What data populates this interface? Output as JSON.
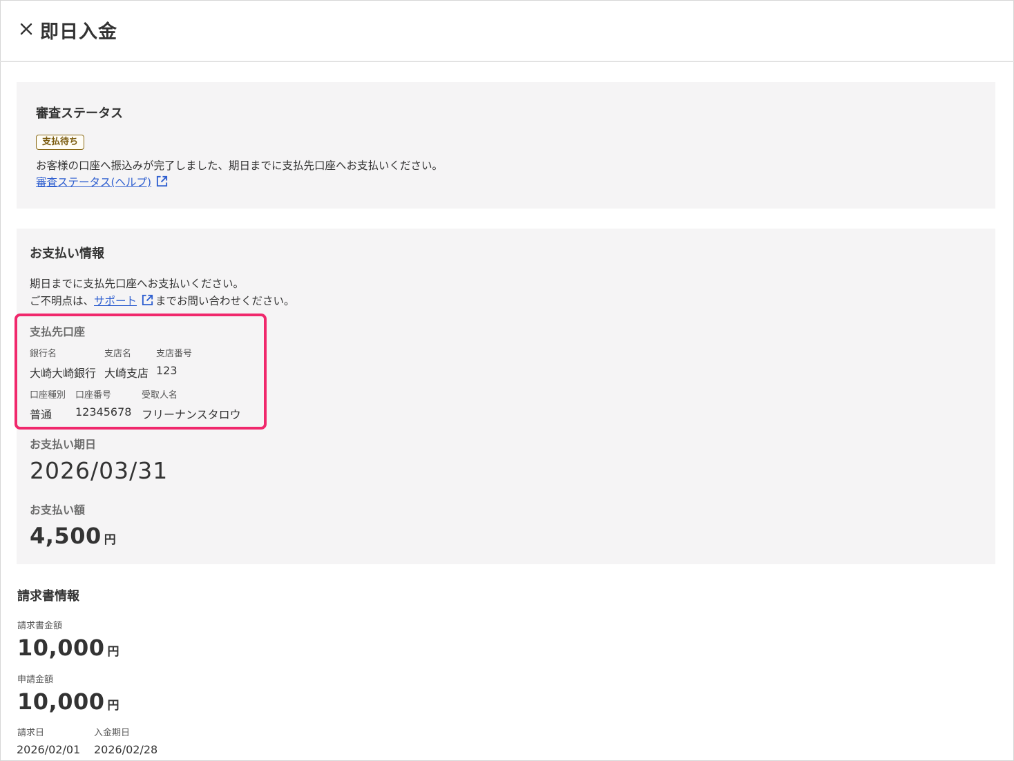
{
  "header": {
    "title": "即日入金"
  },
  "review_status": {
    "heading": "審査ステータス",
    "badge": "支払待ち",
    "message": "お客様の口座へ振込みが完了しました、期日までに支払先口座へお支払いください。",
    "help_link": "審査ステータス(ヘルプ)"
  },
  "payment_info": {
    "heading": "お支払い情報",
    "line1": "期日までに支払先口座へお支払いください。",
    "line2_prefix": "ご不明点は、",
    "support_link": "サポート",
    "line2_suffix": "までお問い合わせください。",
    "account": {
      "heading": "支払先口座",
      "bank_label": "銀行名",
      "bank_value": "大崎大崎銀行",
      "branch_label": "支店名",
      "branch_value": "大崎支店",
      "branch_no_label": "支店番号",
      "branch_no_value": "123",
      "type_label": "口座種別",
      "type_value": "普通",
      "number_label": "口座番号",
      "number_value": "12345678",
      "holder_label": "受取人名",
      "holder_value": "フリーナンスタロウ"
    },
    "due_label": "お支払い期日",
    "due_value": "2026/03/31",
    "amount_label": "お支払い額",
    "amount_value": "4,500",
    "currency": "円"
  },
  "invoice_info": {
    "heading": "請求書情報",
    "invoice_amount_label": "請求書金額",
    "invoice_amount_value": "10,000",
    "applied_amount_label": "申請金額",
    "applied_amount_value": "10,000",
    "currency": "円",
    "invoice_date_label": "請求日",
    "invoice_date_value": "2026/02/01",
    "deposit_due_label": "入金期日",
    "deposit_due_value": "2026/02/28"
  },
  "colors": {
    "link": "#2f5fd0",
    "highlight": "#f0286c",
    "panel_bg": "#f5f4f5",
    "badge": "#8a6a16"
  }
}
